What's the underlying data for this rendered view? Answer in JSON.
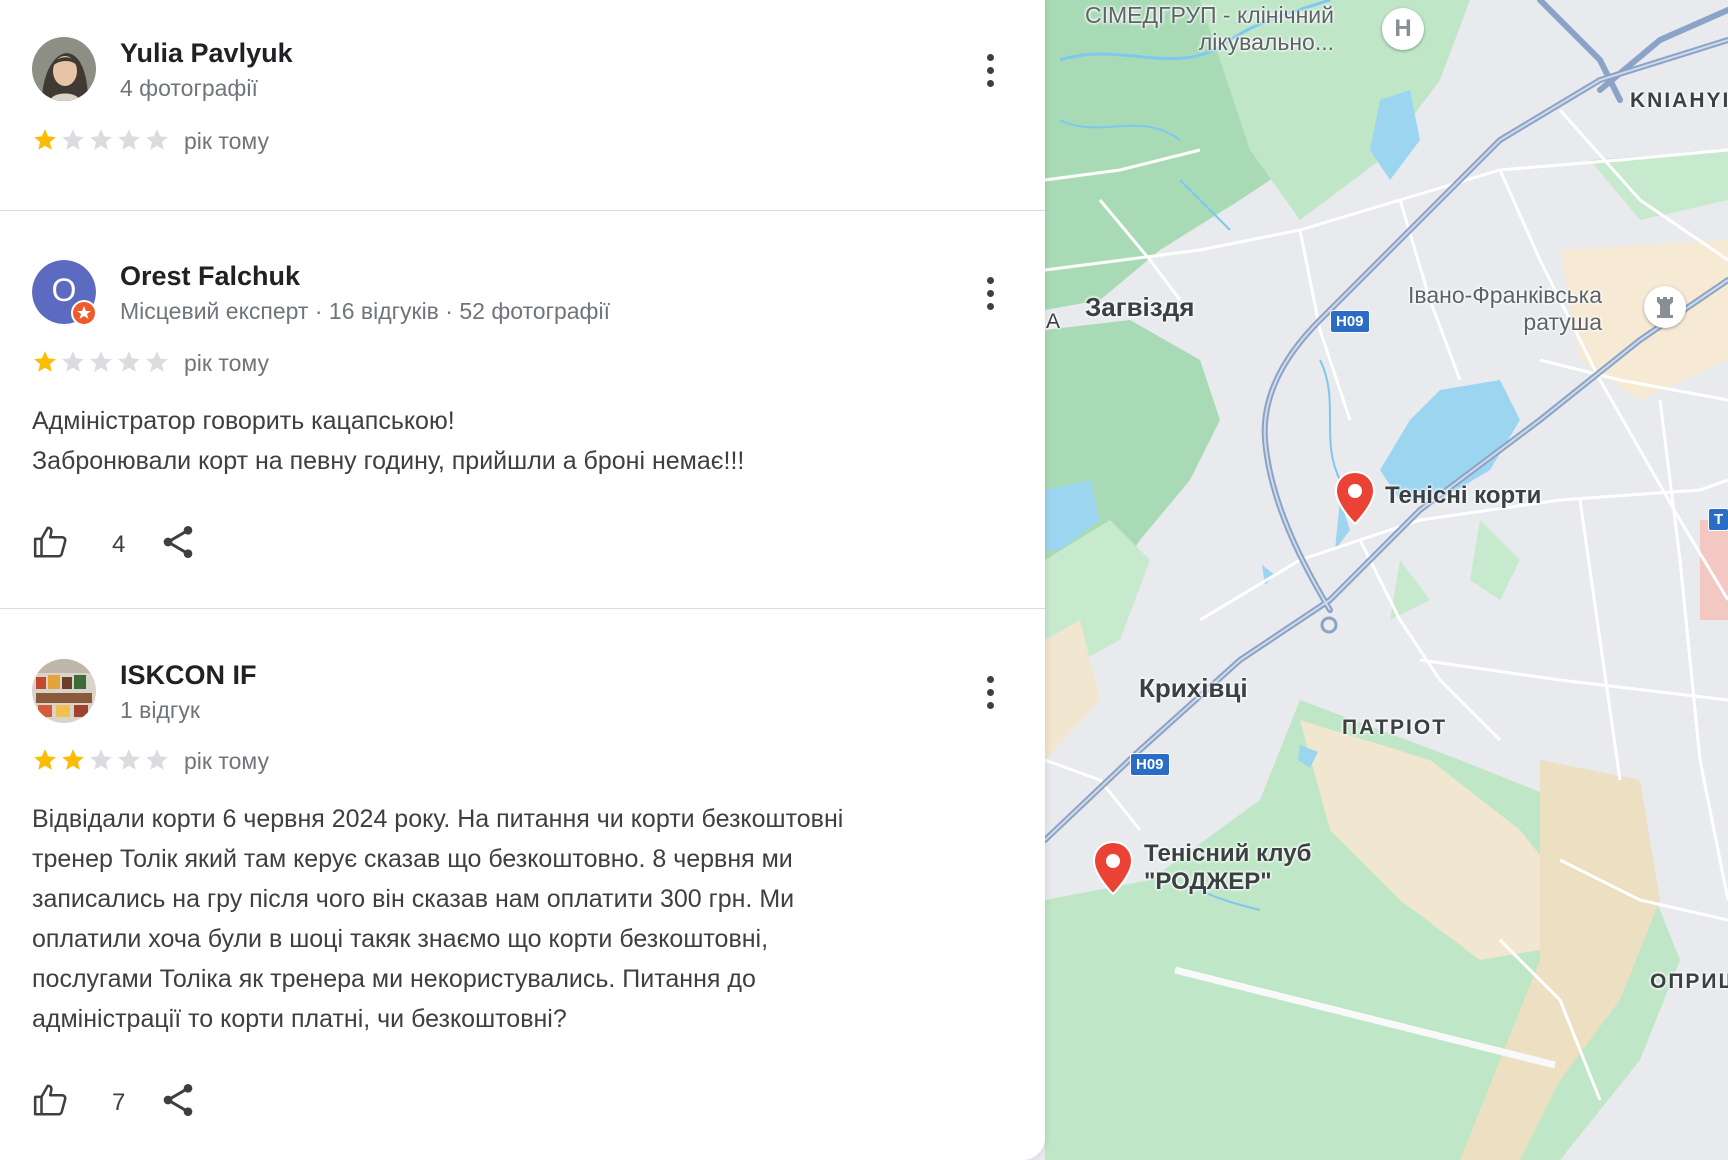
{
  "reviews": [
    {
      "author": "Yulia Pavlyuk",
      "meta": "4 фотографії",
      "rating": 1,
      "time": "рік тому",
      "text": [],
      "likes": null,
      "avatar": "photo"
    },
    {
      "author": "Orest Falchuk",
      "meta": "Місцевий експерт · 16 відгуків · 52 фотографії",
      "rating": 1,
      "time": "рік тому",
      "avatar_letter": "O",
      "avatar_color": "#5c6bc0",
      "text": [
        "Адміністратор говорить кацапською!",
        "Забронювали корт на певну годину, прийшли а броні немає!!!"
      ],
      "likes": "4"
    },
    {
      "author": "ISKCON IF",
      "meta": "1 відгук",
      "rating": 2,
      "time": "рік тому",
      "avatar": "photo",
      "text": [
        "Відвідали корти 6 червня 2024 року. На питання чи корти безкоштовні",
        "тренер Толік який там керує сказав що безкоштовно. 8 червня ми",
        "записались на гру після чого він сказав нам оплатити 300 грн. Ми",
        "оплатили хоча були в шоці такяк знаємо що корти безкоштовні,",
        "послугами Толіка як тренера ми некористувались. Питання до",
        "адміністрації то корти платні, чи безкоштовні?"
      ],
      "likes": "7"
    }
  ],
  "icons": {
    "more": "more-vert-icon",
    "like": "thumb-up-icon",
    "share": "share-icon",
    "star_filled": "star-filled-icon",
    "star_empty": "star-empty-icon",
    "hospital": "hospital-icon",
    "landmark": "landmark-icon",
    "pin": "red-map-pin-icon"
  },
  "colors": {
    "star_filled": "#fbbc04",
    "star_empty": "#dadce0",
    "pin": "#ea4335",
    "road": "#2b6cc4"
  },
  "map": {
    "labels": {
      "simed": "СІМЕДГРУП - клінічний",
      "simed2": "лікувально...",
      "kniahyn": "KNIAHYI",
      "zagvizdia": "Загвіздя",
      "a_edge": "A",
      "ratusha1": "Івано-Франківська",
      "ratusha2": "ратуша",
      "tennis_courts": "Тенісні корти",
      "krykhivtsi": "Крихівці",
      "patriot": "ПАТРІОТ",
      "tennis_club1": "Тенісний клуб",
      "tennis_club2": "\"РОДЖЕР\"",
      "opryshivtsi": "ОПРИШ",
      "t_edge": "Т",
      "h_icon": "H"
    },
    "road_badges": [
      "H09",
      "H09"
    ]
  }
}
